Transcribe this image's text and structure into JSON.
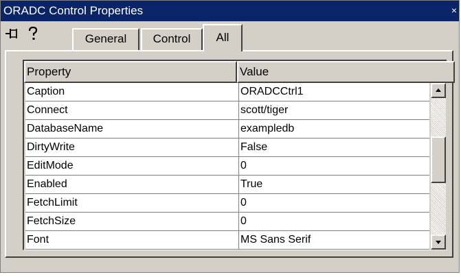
{
  "window": {
    "title": "ORADC Control Properties",
    "close_icon": "×"
  },
  "toolbar": {
    "pin_icon": "pushpin-icon",
    "help_icon": "help-icon"
  },
  "tabs": [
    {
      "label": "General",
      "active": false
    },
    {
      "label": "Control",
      "active": false
    },
    {
      "label": "All",
      "active": true
    }
  ],
  "grid": {
    "columns": [
      "Property",
      "Value"
    ],
    "rows": [
      {
        "property": "Caption",
        "value": "ORADCCtrl1"
      },
      {
        "property": "Connect",
        "value": "scott/tiger"
      },
      {
        "property": "DatabaseName",
        "value": "exampledb"
      },
      {
        "property": "DirtyWrite",
        "value": "False"
      },
      {
        "property": "EditMode",
        "value": "0"
      },
      {
        "property": "Enabled",
        "value": "True"
      },
      {
        "property": "FetchLimit",
        "value": "0"
      },
      {
        "property": "FetchSize",
        "value": "0"
      },
      {
        "property": "Font",
        "value": "MS Sans Serif"
      }
    ]
  },
  "colors": {
    "titlebar": "#0a246a",
    "face": "#d4d0c8",
    "grid_bg": "#ffffff"
  }
}
